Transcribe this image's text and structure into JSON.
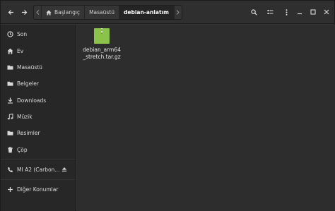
{
  "header": {
    "breadcrumbs": [
      {
        "label": "Başlangıç",
        "icon": "home-icon",
        "active": false
      },
      {
        "label": "Masaüstü",
        "active": false
      },
      {
        "label": "debian-anlatım",
        "active": true
      }
    ],
    "tool_icons": [
      "search-icon",
      "view-list-icon",
      "menu-icon"
    ],
    "window_controls": [
      "minimize-icon",
      "maximize-icon",
      "close-icon"
    ]
  },
  "sidebar": {
    "items": [
      {
        "label": "Son",
        "icon": "clock-icon"
      },
      {
        "label": "Ev",
        "icon": "home-icon"
      },
      {
        "label": "Masaüstü",
        "icon": "folder-icon"
      },
      {
        "label": "Belgeler",
        "icon": "folder-icon"
      },
      {
        "label": "Downloads",
        "icon": "download-icon"
      },
      {
        "label": "Müzik",
        "icon": "music-icon"
      },
      {
        "label": "Resimler",
        "icon": "folder-icon"
      },
      {
        "label": "Çöp",
        "icon": "trash-icon"
      },
      {
        "label": "MI A2 (Carbon...",
        "icon": "phone-icon"
      },
      {
        "label": "Diğer Konumlar",
        "icon": "plus-icon"
      }
    ]
  },
  "main": {
    "files": [
      {
        "name": "debian_arm64_stretch.tar.gz",
        "icon": "archive-icon",
        "color": "#8bc34a"
      }
    ]
  },
  "colors": {
    "window_bg": "#333333",
    "sidebar_bg": "#272727",
    "main_bg": "#2d2d2d",
    "archive_green": "#8bc34a"
  }
}
